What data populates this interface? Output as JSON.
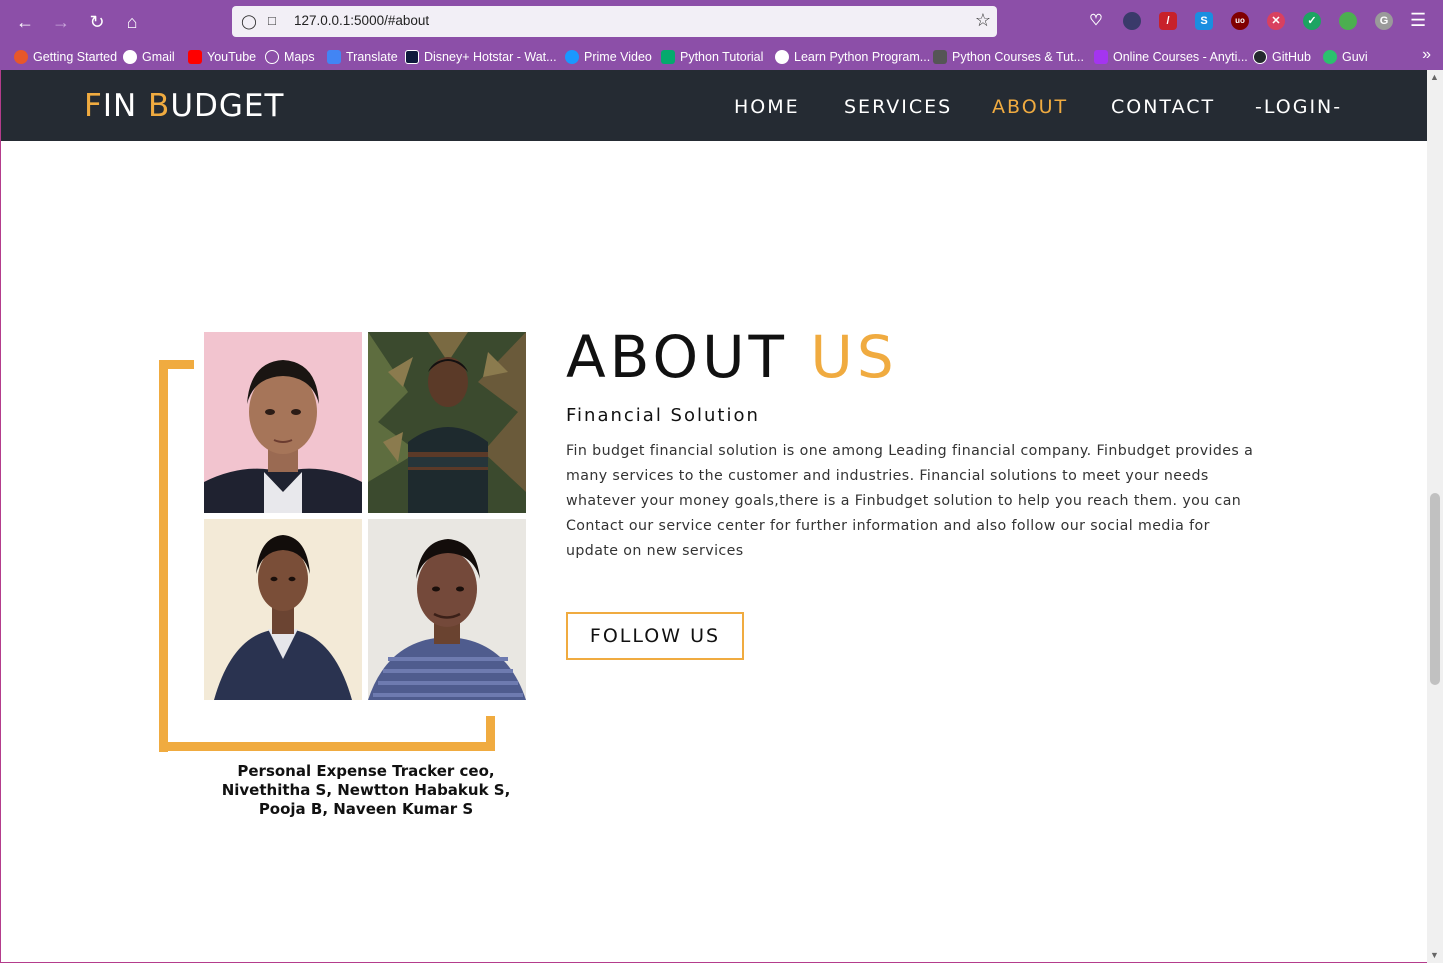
{
  "browser": {
    "url": "127.0.0.1:5000/#about",
    "bookmarks": [
      {
        "label": "Getting Started",
        "color": "#e8572a"
      },
      {
        "label": "Gmail",
        "color": "#ffffff"
      },
      {
        "label": "YouTube",
        "color": "#ff0000"
      },
      {
        "label": "Maps",
        "color": "#ffffff"
      },
      {
        "label": "Translate",
        "color": "#4285f4"
      },
      {
        "label": "Disney+ Hotstar - Wat...",
        "color": "#0f1a3c"
      },
      {
        "label": "Prime Video",
        "color": "#1a98ff"
      },
      {
        "label": "Python Tutorial",
        "color": "#04aa6d"
      },
      {
        "label": "Learn Python Program...",
        "color": "#ffffff"
      },
      {
        "label": "Python Courses & Tut...",
        "color": "#555555"
      },
      {
        "label": "Online Courses - Anyti...",
        "color": "#a435f0"
      },
      {
        "label": "GitHub",
        "color": "#24292e"
      },
      {
        "label": "Guvi",
        "color": "#2bc16e"
      }
    ]
  },
  "site": {
    "logo_first_initial": "F",
    "logo_first_rest": "IN ",
    "logo_second_initial": "B",
    "logo_second_rest": "UDGET",
    "nav": {
      "home": "HOME",
      "services": "SERVICES",
      "about": "ABOUT",
      "contact": "CONTACT",
      "login": "-LOGIN-"
    },
    "accent_color": "#f0ab40",
    "nav_bg": "#252b33"
  },
  "about": {
    "title_main": "ABOUT ",
    "title_accent": "US",
    "subtitle": "Financial Solution",
    "description": "Fin budget financial solution is one among Leading financial company. Finbudget provides a many services to the customer and industries. Financial solutions to meet your needs whatever your money goals,there is a Finbudget solution to help you reach them. you can Contact our service center for further information and also follow our social media for update on new services",
    "follow_button": "FOLLOW US",
    "caption": "Personal Expense Tracker ceo, Nivethitha S, Newtton Habakuk S, Pooja B, Naveen Kumar S"
  }
}
